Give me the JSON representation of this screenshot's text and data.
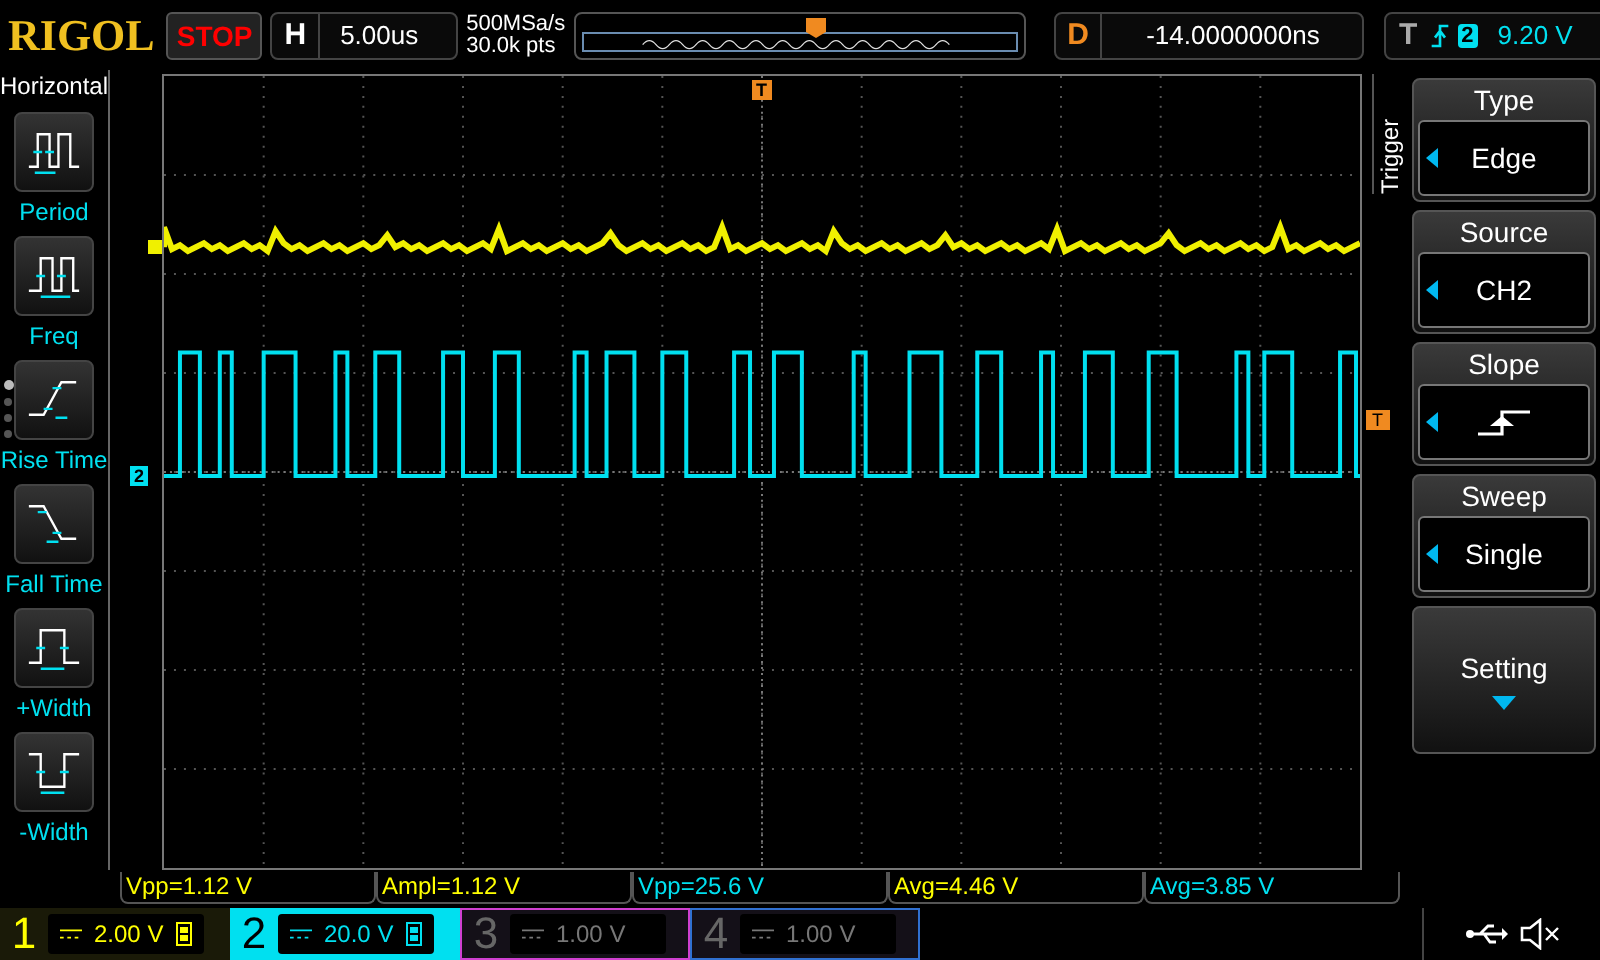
{
  "top_bar": {
    "logo": "RIGOL",
    "run_state": "STOP",
    "timebase_label": "H",
    "timebase": "5.00us",
    "sample_rate": "500MSa/s",
    "memory_depth": "30.0k pts",
    "delay_label": "D",
    "delay": "-14.0000000ns",
    "trigger_label": "T",
    "trigger_source": "2",
    "trigger_level": "9.20 V"
  },
  "left_menu": {
    "title": "Horizontal",
    "items": [
      {
        "kind": "period",
        "label": "Period"
      },
      {
        "kind": "freq",
        "label": "Freq"
      },
      {
        "kind": "rise",
        "label": "Rise Time"
      },
      {
        "kind": "fall",
        "label": "Fall Time"
      },
      {
        "kind": "pwidth",
        "label": "+Width"
      },
      {
        "kind": "nwidth",
        "label": "-Width"
      }
    ],
    "pages": [
      {
        "selected": true
      },
      {
        "selected": false
      },
      {
        "selected": false
      },
      {
        "selected": false
      }
    ]
  },
  "markers": {
    "time_trigger": "T",
    "level_trigger": "T",
    "channel_2": "2"
  },
  "right_menu": {
    "title": "Trigger",
    "items": [
      {
        "kind": "value",
        "label": "Type",
        "value": "Edge"
      },
      {
        "kind": "value",
        "label": "Source",
        "value": "CH2"
      },
      {
        "kind": "slope",
        "label": "Slope"
      },
      {
        "kind": "value",
        "label": "Sweep",
        "value": "Single"
      },
      {
        "kind": "submenu",
        "label": "Setting"
      }
    ]
  },
  "measurements": [
    {
      "text": "Vpp=1.12 V",
      "color": "#ffff00"
    },
    {
      "text": "Ampl=1.12 V",
      "color": "#ffff00"
    },
    {
      "text": "Vpp=25.6 V",
      "color": "#00e0f0"
    },
    {
      "text": "Avg=4.46 V",
      "color": "#ffff00"
    },
    {
      "text": "Avg=3.85 V",
      "color": "#00e0f0"
    }
  ],
  "channels": [
    {
      "number": "1",
      "scale": "2.00 V",
      "on": true,
      "selected": false,
      "bw_limit": true,
      "color": "#ffff00"
    },
    {
      "number": "2",
      "scale": "20.0 V",
      "on": true,
      "selected": true,
      "bw_limit": true,
      "color": "#00e0f0"
    },
    {
      "number": "3",
      "scale": "1.00 V",
      "on": false,
      "selected": false,
      "bw_limit": false,
      "color": "#d040d0"
    },
    {
      "number": "4",
      "scale": "1.00 V",
      "on": false,
      "selected": false,
      "bw_limit": false,
      "color": "#3070d0"
    }
  ]
}
